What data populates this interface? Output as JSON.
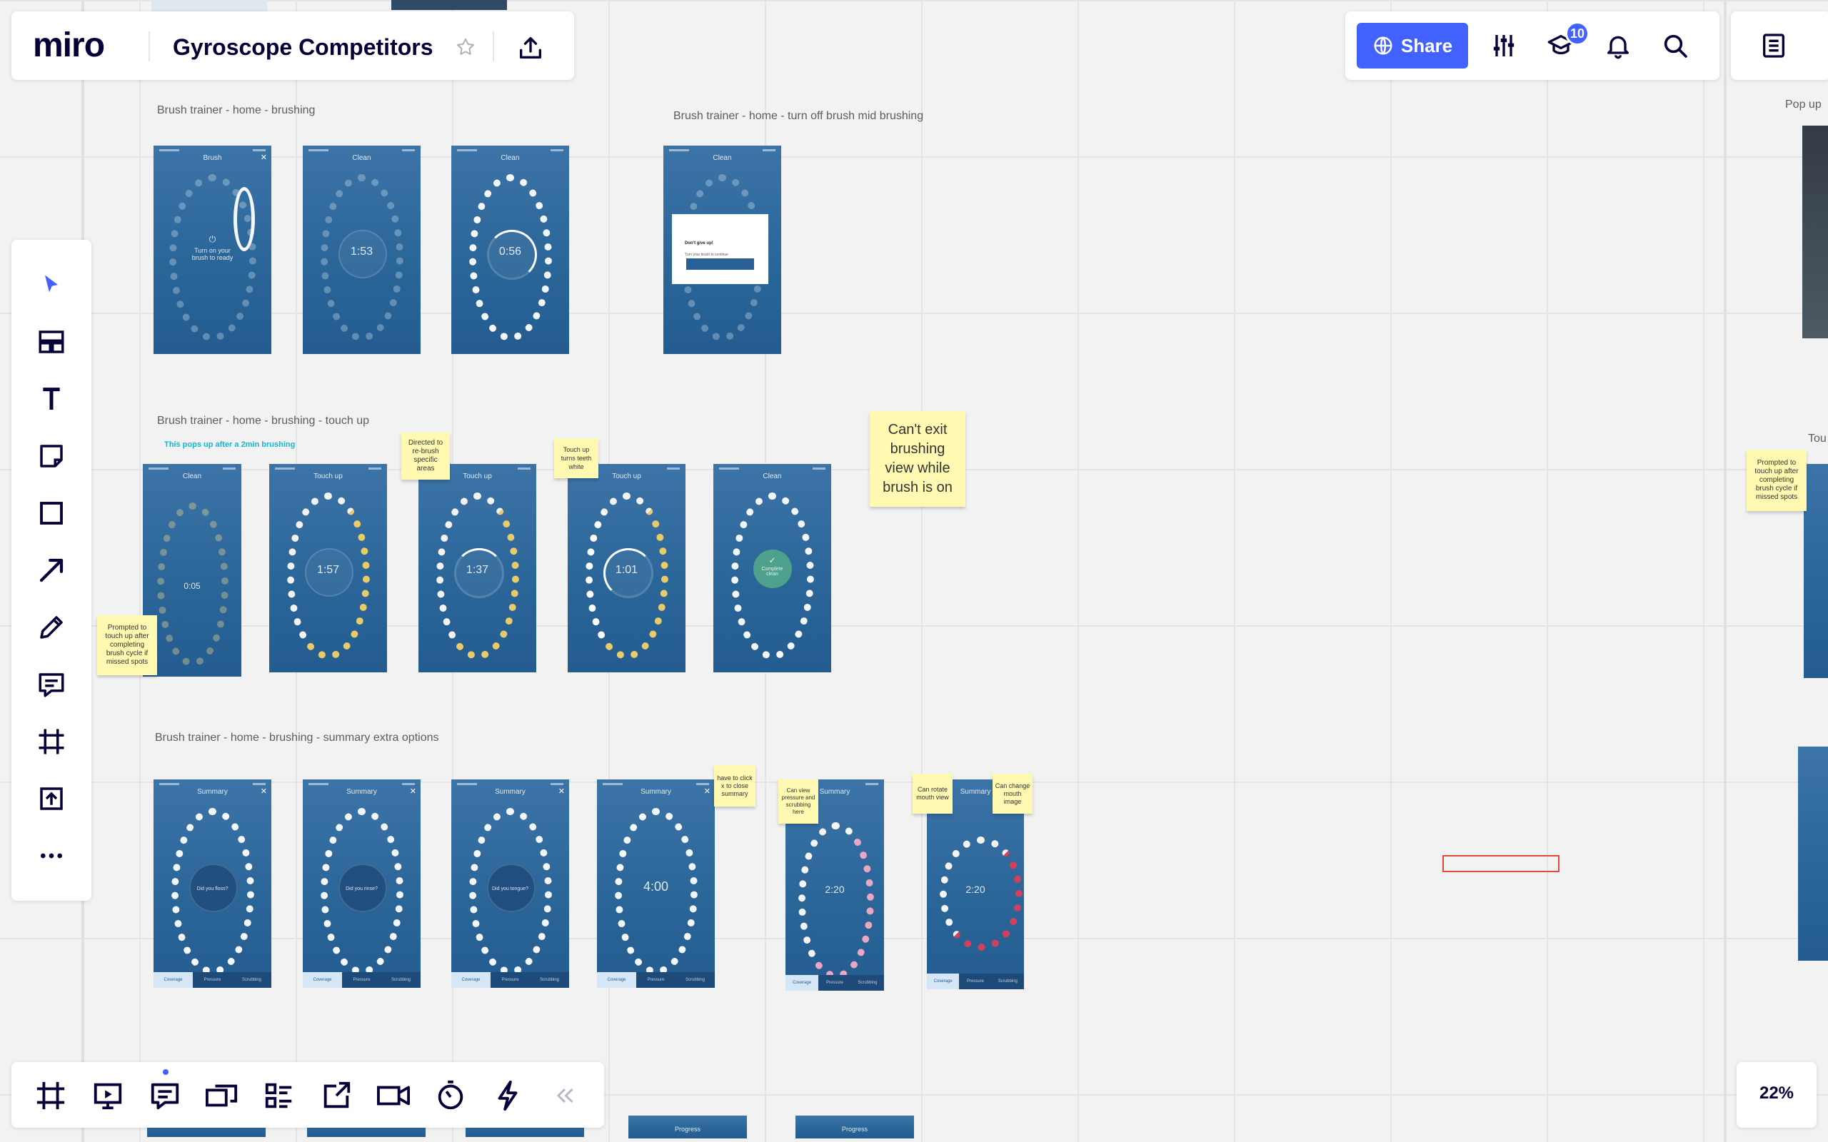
{
  "app": {
    "logo": "miro"
  },
  "board": {
    "title": "Gyroscope Competitors"
  },
  "header": {
    "share_label": "Share",
    "notification_count": "10"
  },
  "sections": [
    {
      "label": "Brush trainer - home - brushing"
    },
    {
      "label": "Brush trainer - home - turn off brush mid brushing"
    },
    {
      "label": "Brush trainer - home - brushing - touch up"
    },
    {
      "label": "Brush trainer - home - brushing - summary extra options"
    }
  ],
  "notes": {
    "popup_note": "This pops up after a 2min brushing",
    "right_label_popup": "Pop up",
    "right_label_touch": "Tou"
  },
  "stickies": [
    {
      "text": "Can't exit brushing view while brush is on"
    },
    {
      "text": "Directed to re-brush specific areas"
    },
    {
      "text": "Touch up turns teeth white"
    },
    {
      "text": "Prompted to touch up after completing brush cycle if missed spots"
    },
    {
      "text": "Prompted to touch up after completing brush cycle if missed spots"
    },
    {
      "text": "have to click x to close summary"
    },
    {
      "text": "Can view pressure and scrubbing here"
    },
    {
      "text": "Can rotate mouth view"
    },
    {
      "text": "Can change mouth image"
    }
  ],
  "screens": {
    "row1": [
      {
        "title": "Brush",
        "center": "Turn on your brush to ready"
      },
      {
        "title": "Clean",
        "center": "1:53"
      },
      {
        "title": "Clean",
        "center": "0:56"
      },
      {
        "title": "Clean",
        "dialog_title": "Don't give up!",
        "dialog_desc": "Turn your brush to continue"
      }
    ],
    "row2": [
      {
        "title": "Clean",
        "center": "0:05"
      },
      {
        "title": "Touch up",
        "center": "1:57"
      },
      {
        "title": "Touch up",
        "center": "1:37"
      },
      {
        "title": "Touch up",
        "center": "1:01"
      },
      {
        "title": "Clean",
        "center": "Complete clean"
      }
    ],
    "row3": [
      {
        "title": "Summary",
        "center": "Did you floss?"
      },
      {
        "title": "Summary",
        "center": "Did you rinse?"
      },
      {
        "title": "Summary",
        "center": "Did you tongue?"
      },
      {
        "title": "Summary",
        "center": "4:00"
      },
      {
        "title": "Summary",
        "center": "2:20"
      },
      {
        "title": "Summary",
        "center": "2:20"
      }
    ],
    "tab_labels": [
      "Coverage",
      "Pressure",
      "Scrubbing"
    ],
    "bottom_strip_label": "Progress"
  },
  "zoom": {
    "value": "22%"
  },
  "icons": {
    "left_toolbar": [
      "select-cursor-icon",
      "templates-icon",
      "text-icon",
      "sticky-note-icon",
      "shape-icon",
      "arrow-icon",
      "pen-icon",
      "comment-icon",
      "frame-icon",
      "upload-icon",
      "more-icon"
    ],
    "bottom_toolbar": [
      "frames-icon",
      "presentation-icon",
      "comments-icon",
      "screen-share-icon",
      "cards-icon",
      "share-screen-icon",
      "video-icon",
      "timer-icon",
      "lightning-icon",
      "collapse-icon"
    ]
  },
  "colors": {
    "accent": "#4262ff",
    "sticky": "#fff9b1",
    "badge": "#4262ff",
    "selection": "#e04a3a"
  }
}
